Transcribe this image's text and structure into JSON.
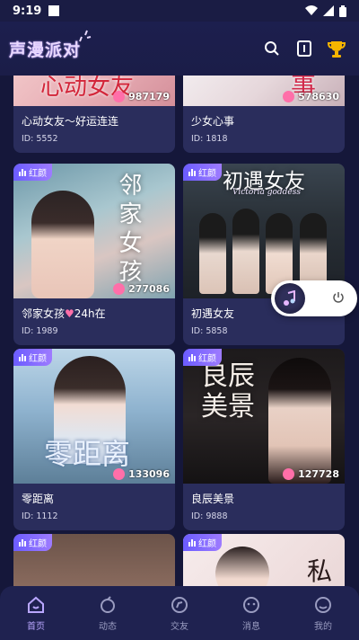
{
  "status": {
    "time": "9:19"
  },
  "app": {
    "title": "声漫派对"
  },
  "header_icons": [
    "search-icon",
    "book-icon",
    "trophy-icon"
  ],
  "cards": [
    {
      "title": "心动女友～好运连连",
      "id": "ID: 5552",
      "count": "987179",
      "overlay": "心动女友"
    },
    {
      "title": "少女心事",
      "id": "ID: 1818",
      "count": "578630",
      "overlay": "事"
    },
    {
      "title": "邻家女孩",
      "title_suffix": "24h在",
      "id": "ID: 1989",
      "count": "277086",
      "tag": "红颜",
      "overlay": "邻家女孩"
    },
    {
      "title": "初遇女友",
      "id": "ID: 5858",
      "tag": "红颜",
      "overlay": "初遇女友",
      "overlay_sub": "Victoria goddess"
    },
    {
      "title": "零距离",
      "id": "ID: 1112",
      "count": "133096",
      "tag": "红颜",
      "overlay": "零距离"
    },
    {
      "title": "良辰美景",
      "id": "ID: 9888",
      "count": "127728",
      "tag": "红颜",
      "overlay": "良辰美景"
    },
    {
      "tag": "红颜"
    },
    {
      "tag": "红颜",
      "overlay": "私"
    }
  ],
  "nav": [
    {
      "label": "首页",
      "icon": "home-icon",
      "active": true
    },
    {
      "label": "动态",
      "icon": "moments-icon"
    },
    {
      "label": "交友",
      "icon": "discover-icon"
    },
    {
      "label": "消息",
      "icon": "message-icon"
    },
    {
      "label": "我的",
      "icon": "profile-icon"
    }
  ],
  "colors": {
    "bg": "#15173a",
    "card": "#2a2d5c",
    "accent": "#8a6dff",
    "tag": "#7b65ff"
  }
}
